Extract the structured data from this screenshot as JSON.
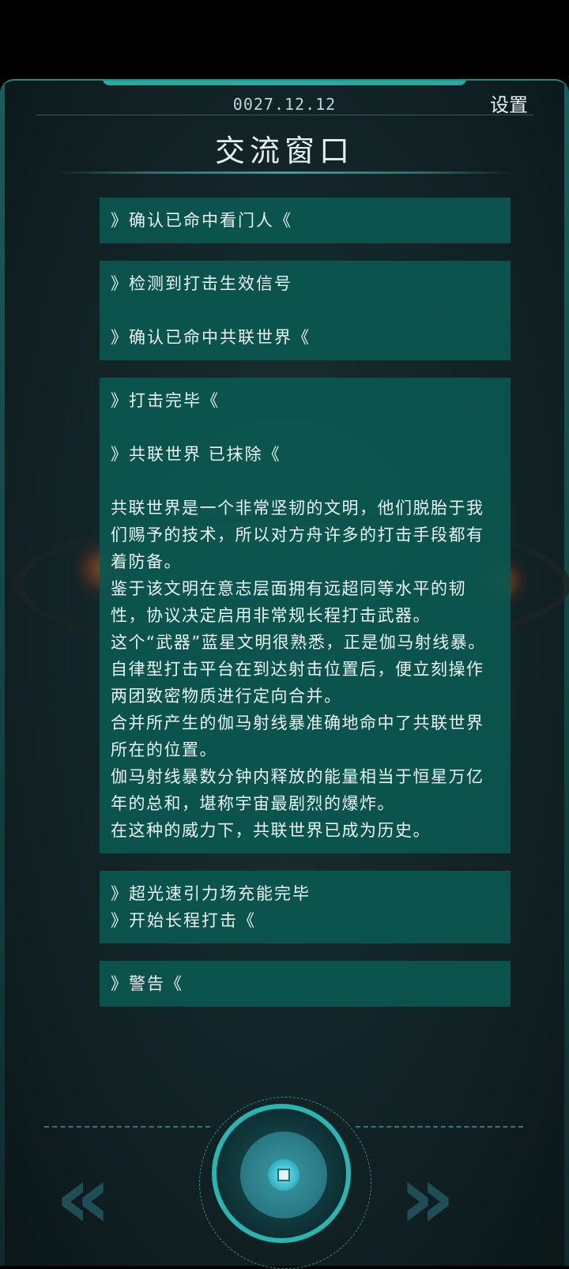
{
  "header": {
    "date": "0027.12.12",
    "settings_label": "设置",
    "title": "交流窗口"
  },
  "messages": [
    {
      "lines": [
        "》确认已命中看门人《"
      ]
    },
    {
      "lines": [
        "》检测到打击生效信号",
        "",
        "》确认已命中共联世界《"
      ]
    },
    {
      "lines": [
        "》打击完毕《",
        "",
        "》共联世界 已抹除《",
        "",
        "共联世界是一个非常坚韧的文明，他们脱胎于我们赐予的技术，所以对方舟许多的打击手段都有着防备。",
        "鉴于该文明在意志层面拥有远超同等水平的韧性，协议决定启用非常规长程打击武器。",
        "这个“武器”蓝星文明很熟悉，正是伽马射线暴。",
        "自律型打击平台在到达射击位置后，便立刻操作两团致密物质进行定向合并。",
        "合并所产生的伽马射线暴准确地命中了共联世界所在的位置。",
        "伽马射线暴数分钟内释放的能量相当于恒星万亿年的总和，堪称宇宙最剧烈的爆炸。",
        "在这种的威力下，共联世界已成为历史。"
      ]
    },
    {
      "lines": [
        "》超光速引力场充能完毕",
        "》开始长程打击《"
      ]
    },
    {
      "lines": [
        "》警告《"
      ]
    }
  ],
  "controls": {
    "prev_icon": "double-chevron-left-icon",
    "next_icon": "double-chevron-right-icon",
    "center_icon": "center-button-icon",
    "prev_glyph": "«",
    "next_glyph": "»"
  },
  "colors": {
    "accent": "#2ab6b0",
    "message_bg": "#0b5750"
  }
}
